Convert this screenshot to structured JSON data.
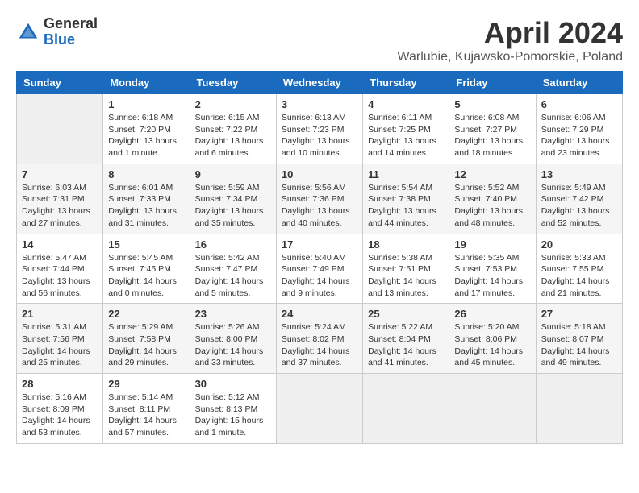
{
  "logo": {
    "general": "General",
    "blue": "Blue"
  },
  "title": "April 2024",
  "subtitle": "Warlubie, Kujawsko-Pomorskie, Poland",
  "days_of_week": [
    "Sunday",
    "Monday",
    "Tuesday",
    "Wednesday",
    "Thursday",
    "Friday",
    "Saturday"
  ],
  "weeks": [
    [
      {
        "day": "",
        "info": ""
      },
      {
        "day": "1",
        "info": "Sunrise: 6:18 AM\nSunset: 7:20 PM\nDaylight: 13 hours\nand 1 minute."
      },
      {
        "day": "2",
        "info": "Sunrise: 6:15 AM\nSunset: 7:22 PM\nDaylight: 13 hours\nand 6 minutes."
      },
      {
        "day": "3",
        "info": "Sunrise: 6:13 AM\nSunset: 7:23 PM\nDaylight: 13 hours\nand 10 minutes."
      },
      {
        "day": "4",
        "info": "Sunrise: 6:11 AM\nSunset: 7:25 PM\nDaylight: 13 hours\nand 14 minutes."
      },
      {
        "day": "5",
        "info": "Sunrise: 6:08 AM\nSunset: 7:27 PM\nDaylight: 13 hours\nand 18 minutes."
      },
      {
        "day": "6",
        "info": "Sunrise: 6:06 AM\nSunset: 7:29 PM\nDaylight: 13 hours\nand 23 minutes."
      }
    ],
    [
      {
        "day": "7",
        "info": "Sunrise: 6:03 AM\nSunset: 7:31 PM\nDaylight: 13 hours\nand 27 minutes."
      },
      {
        "day": "8",
        "info": "Sunrise: 6:01 AM\nSunset: 7:33 PM\nDaylight: 13 hours\nand 31 minutes."
      },
      {
        "day": "9",
        "info": "Sunrise: 5:59 AM\nSunset: 7:34 PM\nDaylight: 13 hours\nand 35 minutes."
      },
      {
        "day": "10",
        "info": "Sunrise: 5:56 AM\nSunset: 7:36 PM\nDaylight: 13 hours\nand 40 minutes."
      },
      {
        "day": "11",
        "info": "Sunrise: 5:54 AM\nSunset: 7:38 PM\nDaylight: 13 hours\nand 44 minutes."
      },
      {
        "day": "12",
        "info": "Sunrise: 5:52 AM\nSunset: 7:40 PM\nDaylight: 13 hours\nand 48 minutes."
      },
      {
        "day": "13",
        "info": "Sunrise: 5:49 AM\nSunset: 7:42 PM\nDaylight: 13 hours\nand 52 minutes."
      }
    ],
    [
      {
        "day": "14",
        "info": "Sunrise: 5:47 AM\nSunset: 7:44 PM\nDaylight: 13 hours\nand 56 minutes."
      },
      {
        "day": "15",
        "info": "Sunrise: 5:45 AM\nSunset: 7:45 PM\nDaylight: 14 hours\nand 0 minutes."
      },
      {
        "day": "16",
        "info": "Sunrise: 5:42 AM\nSunset: 7:47 PM\nDaylight: 14 hours\nand 5 minutes."
      },
      {
        "day": "17",
        "info": "Sunrise: 5:40 AM\nSunset: 7:49 PM\nDaylight: 14 hours\nand 9 minutes."
      },
      {
        "day": "18",
        "info": "Sunrise: 5:38 AM\nSunset: 7:51 PM\nDaylight: 14 hours\nand 13 minutes."
      },
      {
        "day": "19",
        "info": "Sunrise: 5:35 AM\nSunset: 7:53 PM\nDaylight: 14 hours\nand 17 minutes."
      },
      {
        "day": "20",
        "info": "Sunrise: 5:33 AM\nSunset: 7:55 PM\nDaylight: 14 hours\nand 21 minutes."
      }
    ],
    [
      {
        "day": "21",
        "info": "Sunrise: 5:31 AM\nSunset: 7:56 PM\nDaylight: 14 hours\nand 25 minutes."
      },
      {
        "day": "22",
        "info": "Sunrise: 5:29 AM\nSunset: 7:58 PM\nDaylight: 14 hours\nand 29 minutes."
      },
      {
        "day": "23",
        "info": "Sunrise: 5:26 AM\nSunset: 8:00 PM\nDaylight: 14 hours\nand 33 minutes."
      },
      {
        "day": "24",
        "info": "Sunrise: 5:24 AM\nSunset: 8:02 PM\nDaylight: 14 hours\nand 37 minutes."
      },
      {
        "day": "25",
        "info": "Sunrise: 5:22 AM\nSunset: 8:04 PM\nDaylight: 14 hours\nand 41 minutes."
      },
      {
        "day": "26",
        "info": "Sunrise: 5:20 AM\nSunset: 8:06 PM\nDaylight: 14 hours\nand 45 minutes."
      },
      {
        "day": "27",
        "info": "Sunrise: 5:18 AM\nSunset: 8:07 PM\nDaylight: 14 hours\nand 49 minutes."
      }
    ],
    [
      {
        "day": "28",
        "info": "Sunrise: 5:16 AM\nSunset: 8:09 PM\nDaylight: 14 hours\nand 53 minutes."
      },
      {
        "day": "29",
        "info": "Sunrise: 5:14 AM\nSunset: 8:11 PM\nDaylight: 14 hours\nand 57 minutes."
      },
      {
        "day": "30",
        "info": "Sunrise: 5:12 AM\nSunset: 8:13 PM\nDaylight: 15 hours\nand 1 minute."
      },
      {
        "day": "",
        "info": ""
      },
      {
        "day": "",
        "info": ""
      },
      {
        "day": "",
        "info": ""
      },
      {
        "day": "",
        "info": ""
      }
    ]
  ]
}
